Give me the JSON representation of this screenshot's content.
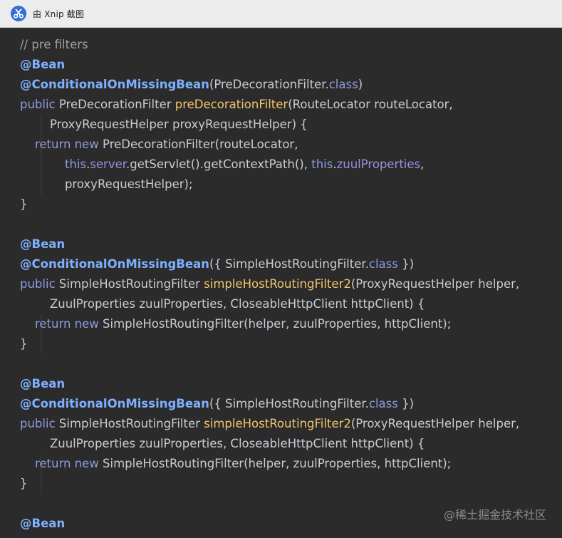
{
  "window": {
    "title": "由 Xnip 截图"
  },
  "colors": {
    "background": "#2b2b2b",
    "comment": "#9aa0a6",
    "annotation": "#7fb0ff",
    "keyword": "#8e9be0",
    "method": "#f2c56f",
    "plain": "#c8ccd4",
    "field": "#9a8fe0"
  },
  "code": {
    "lines": [
      [
        {
          "t": "// pre filters",
          "c": "comment"
        }
      ],
      [
        {
          "t": "@Bean",
          "c": "ann"
        }
      ],
      [
        {
          "t": "@ConditionalOnMissingBean",
          "c": "ann"
        },
        {
          "t": "(PreDecorationFilter.",
          "c": "plain"
        },
        {
          "t": "class",
          "c": "kw"
        },
        {
          "t": ")",
          "c": "plain"
        }
      ],
      [
        {
          "t": "public ",
          "c": "kw"
        },
        {
          "t": "PreDecorationFilter ",
          "c": "plain"
        },
        {
          "t": "preDecorationFilter",
          "c": "method"
        },
        {
          "t": "(RouteLocator routeLocator,",
          "c": "plain"
        }
      ],
      [
        {
          "t": "        ProxyRequestHelper proxyRequestHelper) {",
          "c": "plain"
        }
      ],
      [
        {
          "t": "    ",
          "c": "plain"
        },
        {
          "t": "return new ",
          "c": "kw"
        },
        {
          "t": "PreDecorationFilter(routeLocator,",
          "c": "plain"
        }
      ],
      [
        {
          "t": "            ",
          "c": "plain"
        },
        {
          "t": "this",
          "c": "kw"
        },
        {
          "t": ".",
          "c": "plain"
        },
        {
          "t": "server",
          "c": "field"
        },
        {
          "t": ".getServlet().getContextPath(), ",
          "c": "plain"
        },
        {
          "t": "this",
          "c": "kw"
        },
        {
          "t": ".",
          "c": "plain"
        },
        {
          "t": "zuulProperties",
          "c": "field"
        },
        {
          "t": ",",
          "c": "plain"
        }
      ],
      [
        {
          "t": "            proxyRequestHelper);",
          "c": "plain"
        }
      ],
      [
        {
          "t": "}",
          "c": "plain"
        }
      ],
      [],
      [
        {
          "t": "@Bean",
          "c": "ann"
        }
      ],
      [
        {
          "t": "@ConditionalOnMissingBean",
          "c": "ann"
        },
        {
          "t": "({ SimpleHostRoutingFilter.",
          "c": "plain"
        },
        {
          "t": "class",
          "c": "kw"
        },
        {
          "t": " })",
          "c": "plain"
        }
      ],
      [
        {
          "t": "public ",
          "c": "kw"
        },
        {
          "t": "SimpleHostRoutingFilter ",
          "c": "plain"
        },
        {
          "t": "simpleHostRoutingFilter2",
          "c": "method"
        },
        {
          "t": "(ProxyRequestHelper helper,",
          "c": "plain"
        }
      ],
      [
        {
          "t": "        ZuulProperties zuulProperties, CloseableHttpClient httpClient) {",
          "c": "plain"
        }
      ],
      [
        {
          "t": "    ",
          "c": "plain"
        },
        {
          "t": "return new ",
          "c": "kw"
        },
        {
          "t": "SimpleHostRoutingFilter(helper, zuulProperties, httpClient);",
          "c": "plain"
        }
      ],
      [
        {
          "t": "}",
          "c": "plain"
        }
      ],
      [],
      [
        {
          "t": "@Bean",
          "c": "ann"
        }
      ],
      [
        {
          "t": "@ConditionalOnMissingBean",
          "c": "ann"
        },
        {
          "t": "({ SimpleHostRoutingFilter.",
          "c": "plain"
        },
        {
          "t": "class",
          "c": "kw"
        },
        {
          "t": " })",
          "c": "plain"
        }
      ],
      [
        {
          "t": "public ",
          "c": "kw"
        },
        {
          "t": "SimpleHostRoutingFilter ",
          "c": "plain"
        },
        {
          "t": "simpleHostRoutingFilter2",
          "c": "method"
        },
        {
          "t": "(ProxyRequestHelper helper,",
          "c": "plain"
        }
      ],
      [
        {
          "t": "        ZuulProperties zuulProperties, CloseableHttpClient httpClient) {",
          "c": "plain"
        }
      ],
      [
        {
          "t": "    ",
          "c": "plain"
        },
        {
          "t": "return new ",
          "c": "kw"
        },
        {
          "t": "SimpleHostRoutingFilter(helper, zuulProperties, httpClient);",
          "c": "plain"
        }
      ],
      [
        {
          "t": "}",
          "c": "plain"
        }
      ],
      [],
      [
        {
          "t": "@Bean",
          "c": "ann"
        }
      ]
    ]
  },
  "watermark": "@稀土掘金技术社区"
}
